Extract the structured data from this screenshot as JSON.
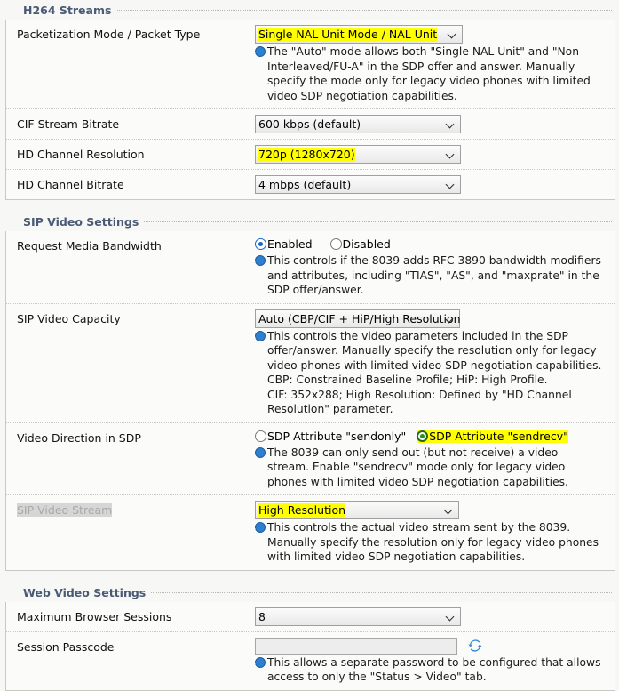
{
  "colors": {
    "highlight": "#ffff00",
    "section_header": "#4a5a75",
    "info_icon": "#2f7fd0",
    "radio_on": "#1668c8",
    "radio_on_green": "#2f8f17"
  },
  "sections": [
    {
      "title": "H264 Streams",
      "rows": [
        {
          "label": "Packetization Mode / Packet Type",
          "control": "select",
          "value": "Single NAL Unit Mode / NAL Unit",
          "value_highlighted": true,
          "help": "The \"Auto\" mode allows both \"Single NAL Unit\" and \"Non-Interleaved/FU-A\" in the SDP offer and answer. Manually specify the mode only for legacy video phones with limited video SDP negotiation capabilities."
        },
        {
          "label": "CIF Stream Bitrate",
          "control": "select",
          "value": "600 kbps (default)",
          "value_highlighted": false,
          "help": ""
        },
        {
          "label": "HD Channel Resolution",
          "control": "select",
          "value": "720p (1280x720)",
          "value_highlighted": true,
          "help": ""
        },
        {
          "label": "HD Channel Bitrate",
          "control": "select",
          "value": "4 mbps (default)",
          "value_highlighted": false,
          "help": ""
        }
      ]
    },
    {
      "title": "SIP Video Settings",
      "rows": [
        {
          "label": "Request Media Bandwidth",
          "control": "radio",
          "options": [
            {
              "label": "Enabled",
              "selected": true,
              "style": "blue",
              "highlighted": false
            },
            {
              "label": "Disabled",
              "selected": false,
              "style": "blue",
              "highlighted": false
            }
          ],
          "help": "This controls if the 8039 adds RFC 3890 bandwidth modifiers and attributes, including \"TIAS\", \"AS\", and \"maxprate\" in the SDP offer/answer."
        },
        {
          "label": "SIP Video Capacity",
          "control": "select",
          "value": "Auto (CBP/CIF + HiP/High Resolution",
          "value_highlighted": false,
          "help": "This controls the video parameters included in the SDP offer/answer. Manually specify the resolution only for legacy video phones with limited video SDP negotiation capabilities.",
          "help_extra": [
            "CBP: Constrained Baseline Profile; HiP: High Profile.",
            "CIF: 352x288; High Resolution: Defined by \"HD Channel Resolution\" parameter."
          ]
        },
        {
          "label": "Video Direction in SDP",
          "control": "radio",
          "options": [
            {
              "label": "SDP Attribute \"sendonly\"",
              "selected": false,
              "style": "blue",
              "highlighted": false
            },
            {
              "label": "SDP Attribute \"sendrecv\"",
              "selected": true,
              "style": "green",
              "highlighted": true
            }
          ],
          "help": "The 8039 can only send out (but not receive) a video stream. Enable \"sendrecv\" mode only for legacy video phones with limited video SDP negotiation capabilities."
        },
        {
          "label": "SIP Video Stream",
          "label_disabled": true,
          "control": "select",
          "value": "High Resolution",
          "value_highlighted": true,
          "help": "This controls the actual video stream sent by the 8039. Manually specify the resolution only for legacy video phones with limited video SDP negotiation capabilities."
        }
      ]
    },
    {
      "title": "Web Video Settings",
      "rows": [
        {
          "label": "Maximum Browser Sessions",
          "control": "select",
          "value": "8",
          "value_highlighted": false,
          "help": ""
        },
        {
          "label": "Session Passcode",
          "control": "text",
          "value": "",
          "placeholder": "",
          "icon": "refresh-icon",
          "help": "This allows a separate password to be configured that allows access to only the \"Status > Video\" tab."
        }
      ]
    }
  ]
}
